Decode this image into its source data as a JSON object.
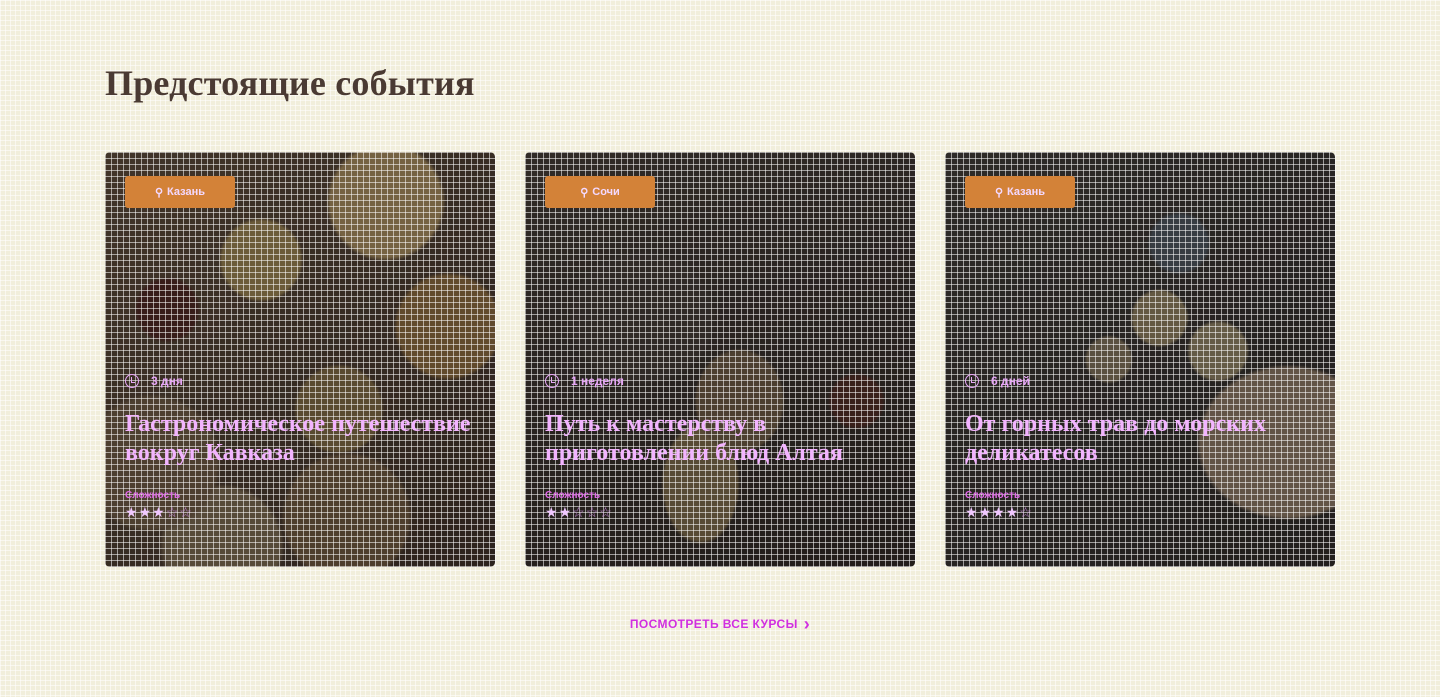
{
  "page": {
    "title": "Предстоящие события",
    "view_all_label": "ПОСМОТРЕТЬ ВСЕ КУРСЫ",
    "view_all_arrow": "›"
  },
  "cards": [
    {
      "location": "Казань",
      "duration": "3 дня",
      "title": "Гастрономическое путешествие вокруг Кавказа",
      "difficulty_label": "Сложность",
      "rating": 3,
      "rating_max": 5
    },
    {
      "location": "Сочи",
      "duration": "1 неделя",
      "title": "Путь к мастерству в приготовлении блюд Алтая",
      "difficulty_label": "Сложность",
      "rating": 2,
      "rating_max": 5
    },
    {
      "location": "Казань",
      "duration": "6 дней",
      "title": "От горных трав до морских деликатесов",
      "difficulty_label": "Сложность",
      "rating": 4,
      "rating_max": 5
    }
  ],
  "icons": {
    "location": "map-pin-icon",
    "duration": "clock-icon",
    "star": "star-icon",
    "arrow": "chevron-right-icon"
  },
  "colors": {
    "background": "#f1eedb",
    "badge": "#d38238",
    "accent": "#d12fe0",
    "title_on_image": "#f2b4ff"
  }
}
